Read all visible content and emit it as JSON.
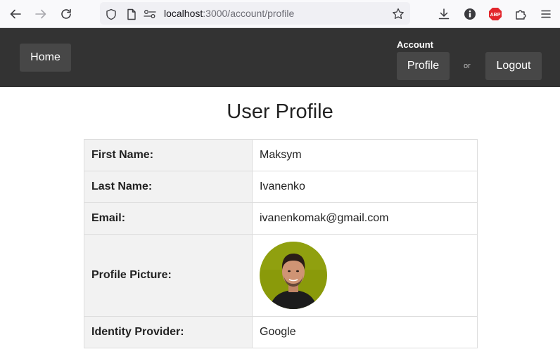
{
  "browser": {
    "url_host": "localhost",
    "url_path": ":3000/account/profile",
    "icons": [
      "back-icon",
      "forward-icon",
      "reload-icon",
      "shield-icon",
      "page-icon",
      "permissions-icon",
      "bookmark-star-icon",
      "download-icon",
      "extension-i-icon",
      "adblock-abp-icon",
      "extensions-puzzle-icon",
      "menu-icon"
    ],
    "abp_text": "ABP"
  },
  "header": {
    "home_label": "Home",
    "account_label": "Account",
    "profile_label": "Profile",
    "or_text": "or",
    "logout_label": "Logout"
  },
  "main": {
    "title": "User Profile",
    "rows": [
      {
        "label": "First Name:",
        "value": "Maksym"
      },
      {
        "label": "Last Name:",
        "value": "Ivanenko"
      },
      {
        "label": "Email:",
        "value": "ivanenkomak@gmail.com"
      },
      {
        "label": "Profile Picture:",
        "value": ""
      },
      {
        "label": "Identity Provider:",
        "value": "Google"
      }
    ]
  },
  "colors": {
    "header_bg": "#333333",
    "header_button_bg": "#474747",
    "label_cell_bg": "#f2f2f2",
    "avatar_bg": "#8a9a0a",
    "abp_red": "#e2262c"
  }
}
